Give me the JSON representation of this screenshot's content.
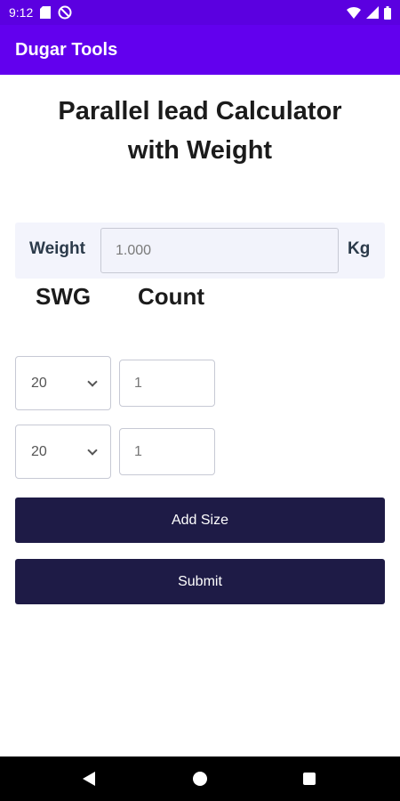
{
  "status_bar": {
    "time": "9:12",
    "left_icons": [
      "sd-card-icon",
      "do-not-disturb-icon"
    ],
    "right_icons": [
      "wifi-icon",
      "signal-icon",
      "battery-icon"
    ]
  },
  "app_bar": {
    "title": "Dugar Tools"
  },
  "page": {
    "title_line1": "Parallel lead Calculator",
    "title_line2": "with Weight"
  },
  "weight": {
    "label": "Weight",
    "value": "1.000",
    "unit": "Kg"
  },
  "columns": {
    "swg": "SWG",
    "count": "Count"
  },
  "sizes": [
    {
      "swg": "20",
      "count": "1"
    },
    {
      "swg": "20",
      "count": "1"
    }
  ],
  "buttons": {
    "add_size": "Add Size",
    "submit": "Submit"
  },
  "colors": {
    "app_bar": "#6200ee",
    "button": "#1e1b46"
  }
}
